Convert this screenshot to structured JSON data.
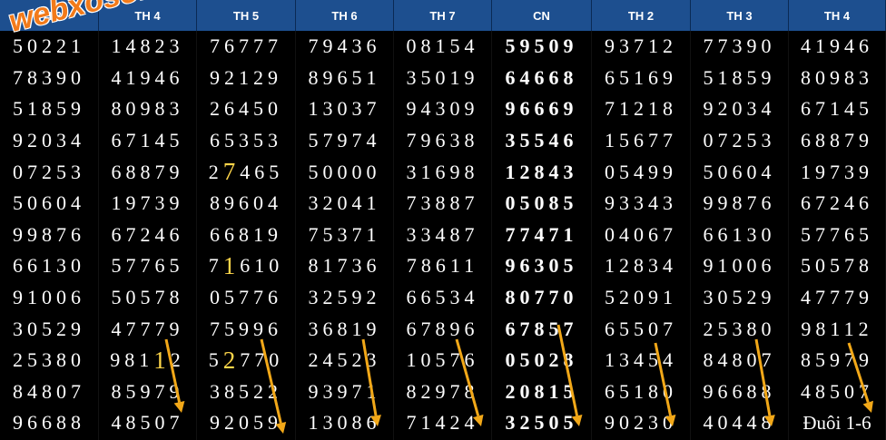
{
  "table": {
    "columns": [
      {
        "header": "TH 3",
        "bold": false,
        "cells": [
          "50221",
          "78390",
          "51859",
          "92034",
          "07253",
          "50604",
          "99876",
          "66130",
          "91006",
          "30529",
          "25380",
          "84807",
          "96688"
        ]
      },
      {
        "header": "TH 4",
        "bold": false,
        "cells": [
          "14823",
          "41946",
          "80983",
          "67145",
          "68879",
          "19739",
          "67246",
          "57765",
          "50578",
          "47779",
          "98112",
          "85979",
          "48507"
        ]
      },
      {
        "header": "TH 5",
        "bold": false,
        "cells": [
          "76777",
          "92129",
          "26450",
          "65353",
          "27465",
          "89604",
          "66819",
          "71610",
          "05776",
          "75996",
          "52770",
          "38522",
          "92059"
        ]
      },
      {
        "header": "TH 6",
        "bold": false,
        "cells": [
          "79436",
          "89651",
          "13037",
          "57974",
          "50000",
          "32041",
          "75371",
          "81736",
          "32592",
          "36819",
          "24523",
          "93971",
          "13086"
        ]
      },
      {
        "header": "TH 7",
        "bold": false,
        "cells": [
          "08154",
          "35019",
          "94309",
          "79638",
          "31698",
          "73887",
          "33487",
          "78611",
          "66534",
          "67896",
          "10576",
          "82978",
          "71424"
        ]
      },
      {
        "header": "CN",
        "bold": true,
        "cells": [
          "59509",
          "64668",
          "96669",
          "35546",
          "12843",
          "05085",
          "77471",
          "96305",
          "80770",
          "67857",
          "05028",
          "20815",
          "32505"
        ]
      },
      {
        "header": "TH 2",
        "bold": false,
        "cells": [
          "93712",
          "65169",
          "71218",
          "15677",
          "05499",
          "93343",
          "04067",
          "12834",
          "52091",
          "65507",
          "13454",
          "65180",
          "90230"
        ]
      },
      {
        "header": "TH 3",
        "bold": false,
        "cells": [
          "77390",
          "51859",
          "92034",
          "07253",
          "50604",
          "99876",
          "66130",
          "91006",
          "30529",
          "25380",
          "84807",
          "96688",
          "40448"
        ]
      },
      {
        "header": "TH 4",
        "bold": false,
        "cells": [
          "41946",
          "80983",
          "67145",
          "68879",
          "19739",
          "67246",
          "57765",
          "50578",
          "47779",
          "98112",
          "85979",
          "48507",
          "Đuôi 1-6"
        ]
      }
    ]
  },
  "highlights": [
    {
      "col": 2,
      "row": 4,
      "char": 1,
      "color": "#ffd64a"
    },
    {
      "col": 2,
      "row": 7,
      "char": 1,
      "color": "#ffd64a"
    },
    {
      "col": 2,
      "row": 10,
      "char": 1,
      "color": "#ffd64a"
    },
    {
      "col": 1,
      "row": 10,
      "char": 3,
      "color": "#ffd64a"
    }
  ],
  "watermark": "webxoso.net",
  "colors": {
    "header_bg": "#1d4f8f",
    "background": "#000000",
    "text": "#ffffff",
    "highlight": "#ffd64a",
    "arrow": "#f2a818",
    "watermark": "#f27a1a"
  }
}
